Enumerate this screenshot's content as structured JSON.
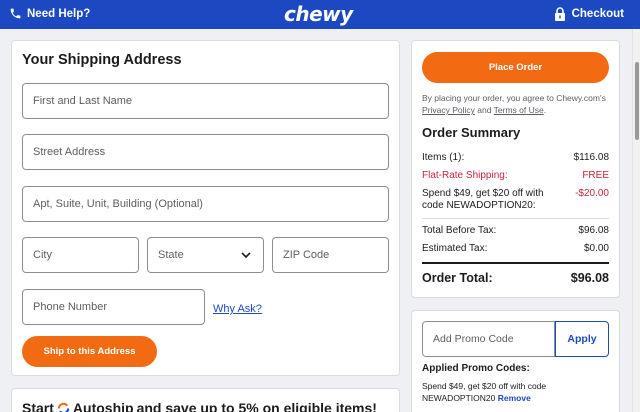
{
  "header": {
    "help_label": "Need Help?",
    "logo_text": "chewy",
    "checkout_label": "Checkout",
    "bg_color": "#1c49c2"
  },
  "shipping": {
    "title": "Your Shipping Address",
    "name_placeholder": "First and Last Name",
    "street_placeholder": "Street Address",
    "apt_placeholder": "Apt, Suite, Unit, Building (Optional)",
    "city_placeholder": "City",
    "state_placeholder": "State",
    "zip_placeholder": "ZIP Code",
    "phone_placeholder": "Phone Number",
    "why_ask": "Why Ask?",
    "ship_button": "Ship to this Address"
  },
  "order": {
    "place_button": "Place Order",
    "agree_prefix": "By placing your order, you agree to Chewy.com's ",
    "privacy_link": "Privacy Policy",
    "agree_and": " and ",
    "terms_link": "Terms of Use",
    "agree_suffix": ".",
    "summary_title": "Order Summary",
    "items_label": "Items (1):",
    "items_value": "$116.08",
    "shipping_label": "Flat-Rate Shipping:",
    "shipping_value": "FREE",
    "promo_label": "Spend $49, get $20 off with code NEWADOPTION20:",
    "promo_value": "-$20.00",
    "before_tax_label": "Total Before Tax:",
    "before_tax_value": "$96.08",
    "est_tax_label": "Estimated Tax:",
    "est_tax_value": "$0.00",
    "total_label": "Order Total:",
    "total_value": "$96.08"
  },
  "promo": {
    "input_placeholder": "Add Promo Code",
    "apply_label": "Apply",
    "applied_title": "Applied Promo Codes:",
    "applied_text": "Spend $49, get $20 off with code NEWADOPTION20 ",
    "remove_label": "Remove"
  },
  "autoship": {
    "prefix": "Start",
    "brand": "Autoship",
    "suffix": "and save up to 5% on eligible items!"
  },
  "colors": {
    "accent": "#f26b12",
    "brand_blue": "#1c49c2",
    "discount_red": "#c8243a"
  }
}
